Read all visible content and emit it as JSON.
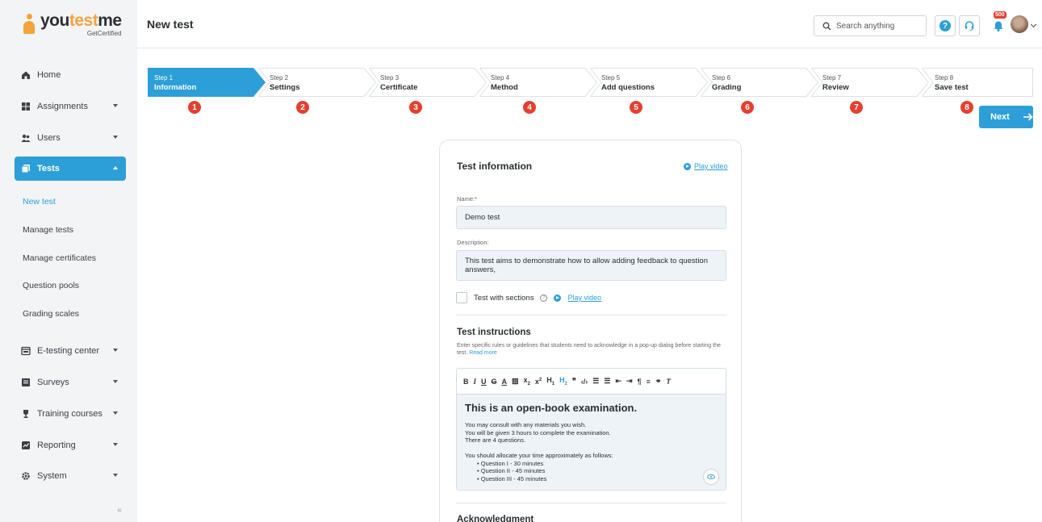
{
  "brand": {
    "name_part1": "you",
    "name_part2": "test",
    "name_part3": "me",
    "sub": "GetCertified"
  },
  "sidebar": {
    "items": [
      {
        "label": "Home",
        "icon": "home-icon"
      },
      {
        "label": "Assignments",
        "icon": "assignments-icon"
      },
      {
        "label": "Users",
        "icon": "users-icon"
      },
      {
        "label": "Tests",
        "icon": "tests-icon"
      }
    ],
    "sub_items": [
      "New test",
      "Manage tests",
      "Manage certificates",
      "Question pools",
      "Grading scales"
    ],
    "items_after": [
      {
        "label": "E-testing center",
        "icon": "e-testing-icon"
      },
      {
        "label": "Surveys",
        "icon": "surveys-icon"
      },
      {
        "label": "Training courses",
        "icon": "training-icon"
      },
      {
        "label": "Reporting",
        "icon": "reporting-icon"
      },
      {
        "label": "System",
        "icon": "gear-icon"
      }
    ],
    "collapse_glyph": "«"
  },
  "header": {
    "title": "New test",
    "search_placeholder": "Search anything",
    "help_glyph": "?",
    "notifications_count": "500"
  },
  "steps": [
    {
      "small": "Step 1",
      "name": "Information",
      "num": "1"
    },
    {
      "small": "Step 2",
      "name": "Settings",
      "num": "2"
    },
    {
      "small": "Step 3",
      "name": "Certificate",
      "num": "3"
    },
    {
      "small": "Step 4",
      "name": "Method",
      "num": "4"
    },
    {
      "small": "Step 5",
      "name": "Add questions",
      "num": "5"
    },
    {
      "small": "Step 6",
      "name": "Grading",
      "num": "6"
    },
    {
      "small": "Step 7",
      "name": "Review",
      "num": "7"
    },
    {
      "small": "Step 8",
      "name": "Save test",
      "num": "8"
    }
  ],
  "next_label": "Next",
  "form": {
    "title": "Test information",
    "play_video": "Play video",
    "name_label": "Name:*",
    "name_value": "Demo test",
    "desc_label": "Description:",
    "desc_value": "This test aims to demonstrate how to allow adding feedback to question answers,",
    "sections_label": "Test with sections",
    "sections_play": "Play video",
    "instructions_title": "Test instructions",
    "instructions_desc": "Enter specific rules or guidelines that students need to acknowledge in a pop-up dialog before starting the test.",
    "read_more": "Read more",
    "editor": {
      "heading": "This is an open-book examination.",
      "lines": [
        "You may consult with any materials you wish.",
        "You will be given 3 hours to complete the examination.",
        "There are 4 questions."
      ],
      "allocate": "You should allocate your time approximately as follows:",
      "bullets": [
        "• Question I - 30 minutes",
        "• Question II - 45 minutes",
        "• Question III - 45 minutes"
      ]
    },
    "ack_title": "Acknowledgment"
  }
}
